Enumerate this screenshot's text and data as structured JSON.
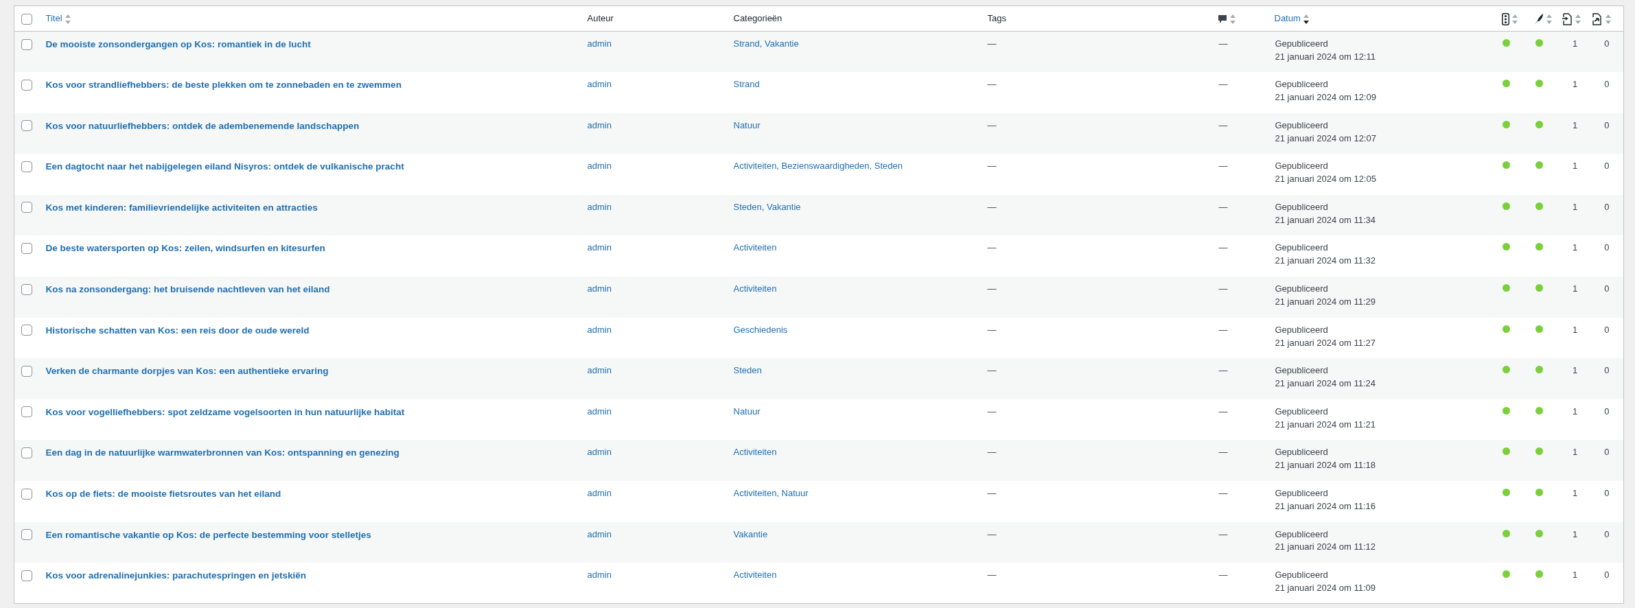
{
  "select_all": {
    "checked": false
  },
  "columns": [
    {
      "kind": "text",
      "label": "Titel",
      "sortable": true,
      "sorted": false
    },
    {
      "kind": "text",
      "label": "Auteur",
      "sortable": false
    },
    {
      "kind": "text",
      "label": "Categorieën",
      "sortable": false
    },
    {
      "kind": "text",
      "label": "Tags",
      "sortable": false
    },
    {
      "kind": "comments",
      "sortable": true,
      "sorted": false
    },
    {
      "kind": "text",
      "label": "Datum",
      "sortable": true,
      "sorted": true
    },
    {
      "kind": "traffic",
      "sortable": true,
      "sorted": false
    },
    {
      "kind": "feather",
      "sortable": true,
      "sorted": false
    },
    {
      "kind": "links_in",
      "sortable": true,
      "sorted": false
    },
    {
      "kind": "links_out",
      "sortable": true,
      "sorted": false
    }
  ],
  "rows": [
    {
      "checked": false,
      "title": "De mooiste zonsondergangen op Kos: romantiek in de lucht",
      "author": "admin",
      "categories": [
        "Strand,",
        "Vakantie"
      ],
      "tags": "—",
      "comments": "—",
      "status": "Gepubliceerd",
      "date": "21 januari 2024 om 12:11",
      "scores": [
        {
          "color": "#7ad03a"
        },
        {
          "color": "#7ad03a"
        }
      ],
      "links_in": "1",
      "links_out": "0"
    },
    {
      "checked": false,
      "title": "Kos voor strandliefhebbers: de beste plekken om te zonnebaden en te zwemmen",
      "author": "admin",
      "categories": [
        "Strand"
      ],
      "tags": "—",
      "comments": "—",
      "status": "Gepubliceerd",
      "date": "21 januari 2024 om 12:09",
      "scores": [
        {
          "color": "#7ad03a"
        },
        {
          "color": "#7ad03a"
        }
      ],
      "links_in": "1",
      "links_out": "0"
    },
    {
      "checked": false,
      "title": "Kos voor natuurliefhebbers: ontdek de adembenemende landschappen",
      "author": "admin",
      "categories": [
        "Natuur"
      ],
      "tags": "—",
      "comments": "—",
      "status": "Gepubliceerd",
      "date": "21 januari 2024 om 12:07",
      "scores": [
        {
          "color": "#7ad03a"
        },
        {
          "color": "#7ad03a"
        }
      ],
      "links_in": "1",
      "links_out": "0"
    },
    {
      "checked": false,
      "title": "Een dagtocht naar het nabijgelegen eiland Nisyros: ontdek de vulkanische pracht",
      "author": "admin",
      "categories": [
        "Activiteiten,",
        "Bezienswaardigheden,",
        "Steden"
      ],
      "tags": "—",
      "comments": "—",
      "status": "Gepubliceerd",
      "date": "21 januari 2024 om 12:05",
      "scores": [
        {
          "color": "#7ad03a"
        },
        {
          "color": "#7ad03a"
        }
      ],
      "links_in": "1",
      "links_out": "0"
    },
    {
      "checked": false,
      "title": "Kos met kinderen: familievriendelijke activiteiten en attracties",
      "author": "admin",
      "categories": [
        "Steden,",
        "Vakantie"
      ],
      "tags": "—",
      "comments": "—",
      "status": "Gepubliceerd",
      "date": "21 januari 2024 om 11:34",
      "scores": [
        {
          "color": "#7ad03a"
        },
        {
          "color": "#7ad03a"
        }
      ],
      "links_in": "1",
      "links_out": "0"
    },
    {
      "checked": false,
      "title": "De beste watersporten op Kos: zeilen, windsurfen en kitesurfen",
      "author": "admin",
      "categories": [
        "Activiteiten"
      ],
      "tags": "—",
      "comments": "—",
      "status": "Gepubliceerd",
      "date": "21 januari 2024 om 11:32",
      "scores": [
        {
          "color": "#7ad03a"
        },
        {
          "color": "#7ad03a"
        }
      ],
      "links_in": "1",
      "links_out": "0"
    },
    {
      "checked": false,
      "title": "Kos na zonsondergang: het bruisende nachtleven van het eiland",
      "author": "admin",
      "categories": [
        "Activiteiten"
      ],
      "tags": "—",
      "comments": "—",
      "status": "Gepubliceerd",
      "date": "21 januari 2024 om 11:29",
      "scores": [
        {
          "color": "#7ad03a"
        },
        {
          "color": "#7ad03a"
        }
      ],
      "links_in": "1",
      "links_out": "0"
    },
    {
      "checked": false,
      "title": "Historische schatten van Kos: een reis door de oude wereld",
      "author": "admin",
      "categories": [
        "Geschiedenis"
      ],
      "tags": "—",
      "comments": "—",
      "status": "Gepubliceerd",
      "date": "21 januari 2024 om 11:27",
      "scores": [
        {
          "color": "#7ad03a"
        },
        {
          "color": "#7ad03a"
        }
      ],
      "links_in": "1",
      "links_out": "0"
    },
    {
      "checked": false,
      "title": "Verken de charmante dorpjes van Kos: een authentieke ervaring",
      "author": "admin",
      "categories": [
        "Steden"
      ],
      "tags": "—",
      "comments": "—",
      "status": "Gepubliceerd",
      "date": "21 januari 2024 om 11:24",
      "scores": [
        {
          "color": "#7ad03a"
        },
        {
          "color": "#7ad03a"
        }
      ],
      "links_in": "1",
      "links_out": "0"
    },
    {
      "checked": false,
      "title": "Kos voor vogelliefhebbers: spot zeldzame vogelsoorten in hun natuurlijke habitat",
      "author": "admin",
      "categories": [
        "Natuur"
      ],
      "tags": "—",
      "comments": "—",
      "status": "Gepubliceerd",
      "date": "21 januari 2024 om 11:21",
      "scores": [
        {
          "color": "#7ad03a"
        },
        {
          "color": "#7ad03a"
        }
      ],
      "links_in": "1",
      "links_out": "0"
    },
    {
      "checked": false,
      "title": "Een dag in de natuurlijke warmwaterbronnen van Kos: ontspanning en genezing",
      "author": "admin",
      "categories": [
        "Activiteiten"
      ],
      "tags": "—",
      "comments": "—",
      "status": "Gepubliceerd",
      "date": "21 januari 2024 om 11:18",
      "scores": [
        {
          "color": "#7ad03a"
        },
        {
          "color": "#7ad03a"
        }
      ],
      "links_in": "1",
      "links_out": "0"
    },
    {
      "checked": false,
      "title": "Kos op de fiets: de mooiste fietsroutes van het eiland",
      "author": "admin",
      "categories": [
        "Activiteiten,",
        "Natuur"
      ],
      "tags": "—",
      "comments": "—",
      "status": "Gepubliceerd",
      "date": "21 januari 2024 om 11:16",
      "scores": [
        {
          "color": "#7ad03a"
        },
        {
          "color": "#7ad03a"
        }
      ],
      "links_in": "1",
      "links_out": "0"
    },
    {
      "checked": false,
      "title": "Een romantische vakantie op Kos: de perfecte bestemming voor stelletjes",
      "author": "admin",
      "categories": [
        "Vakantie"
      ],
      "tags": "—",
      "comments": "—",
      "status": "Gepubliceerd",
      "date": "21 januari 2024 om 11:12",
      "scores": [
        {
          "color": "#7ad03a"
        },
        {
          "color": "#7ad03a"
        }
      ],
      "links_in": "1",
      "links_out": "0"
    },
    {
      "checked": false,
      "title": "Kos voor adrenalinejunkies: parachutespringen en jetskiën",
      "author": "admin",
      "categories": [
        "Activiteiten"
      ],
      "tags": "—",
      "comments": "—",
      "status": "Gepubliceerd",
      "date": "21 januari 2024 om 11:09",
      "scores": [
        {
          "color": "#7ad03a"
        },
        {
          "color": "#7ad03a"
        }
      ],
      "links_in": "1",
      "links_out": "0"
    }
  ]
}
